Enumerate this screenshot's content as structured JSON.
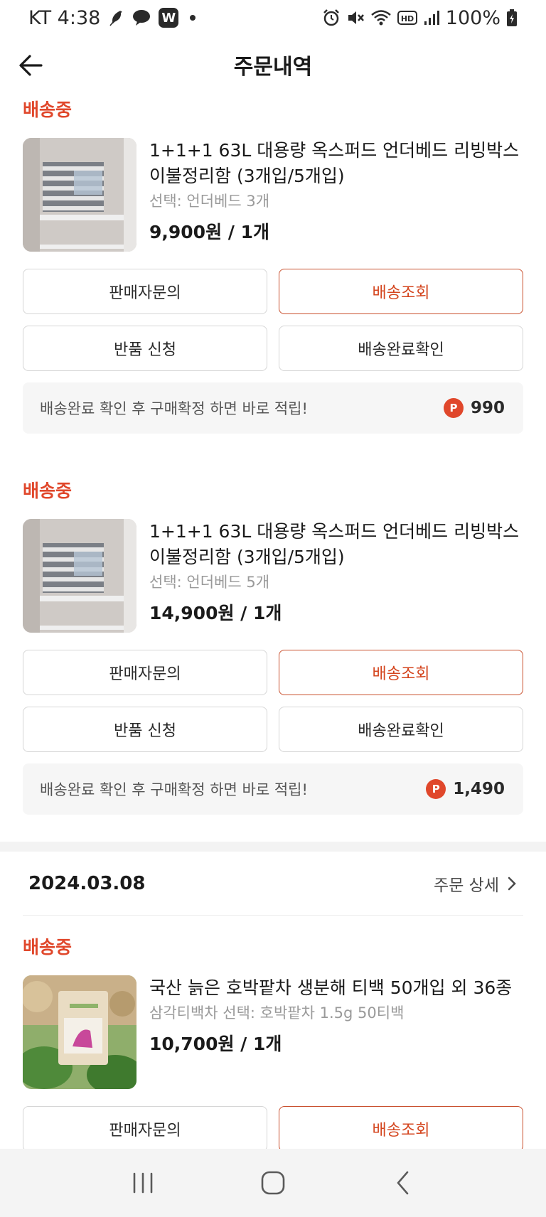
{
  "status_bar": {
    "carrier_time": "KT 4:38",
    "w_badge": "W",
    "battery": "100%",
    "icons": [
      "feather-icon",
      "chat-bubble-icon",
      "w-app-icon",
      "alarm-icon",
      "mute-icon",
      "wifi-icon",
      "hd-icon",
      "signal-icon",
      "battery-icon"
    ]
  },
  "header": {
    "title": "주문내역",
    "back_icon": "arrow-left-icon"
  },
  "orders": [
    {
      "status": "배송중",
      "product_name": "1+1+1 63L 대용량 옥스퍼드 언더베드 리빙박스 이불정리함 (3개입/5개입)",
      "option": "선택: 언더베드 3개",
      "price": "9,900원 / 1개",
      "buttons": {
        "inquiry": "판매자문의",
        "tracking": "배송조회",
        "return": "반품 신청",
        "confirm": "배송완료확인"
      },
      "reward_text": "배송완료 확인 후 구매확정 하면 바로 적립!",
      "reward_points": "990"
    },
    {
      "status": "배송중",
      "product_name": "1+1+1 63L 대용량 옥스퍼드 언더베드 리빙박스 이불정리함 (3개입/5개입)",
      "option": "선택: 언더베드 5개",
      "price": "14,900원 / 1개",
      "buttons": {
        "inquiry": "판매자문의",
        "tracking": "배송조회",
        "return": "반품 신청",
        "confirm": "배송완료확인"
      },
      "reward_text": "배송완료 확인 후 구매확정 하면 바로 적립!",
      "reward_points": "1,490"
    }
  ],
  "order_group": {
    "date": "2024.03.08",
    "detail_link": "주문 상세"
  },
  "order3": {
    "status": "배송중",
    "product_name": "국산 늙은 호박팥차 생분해 티백 50개입 외 36종",
    "option": "삼각티백차 선택: 호박팥차 1.5g 50티백",
    "price": "10,700원 / 1개",
    "buttons": {
      "inquiry": "판매자문의",
      "tracking": "배송조회"
    }
  },
  "point_badge": "P",
  "colors": {
    "accent": "#e0472b",
    "primary_button_border": "#c9502e",
    "reward_bg": "#f6f6f6"
  }
}
